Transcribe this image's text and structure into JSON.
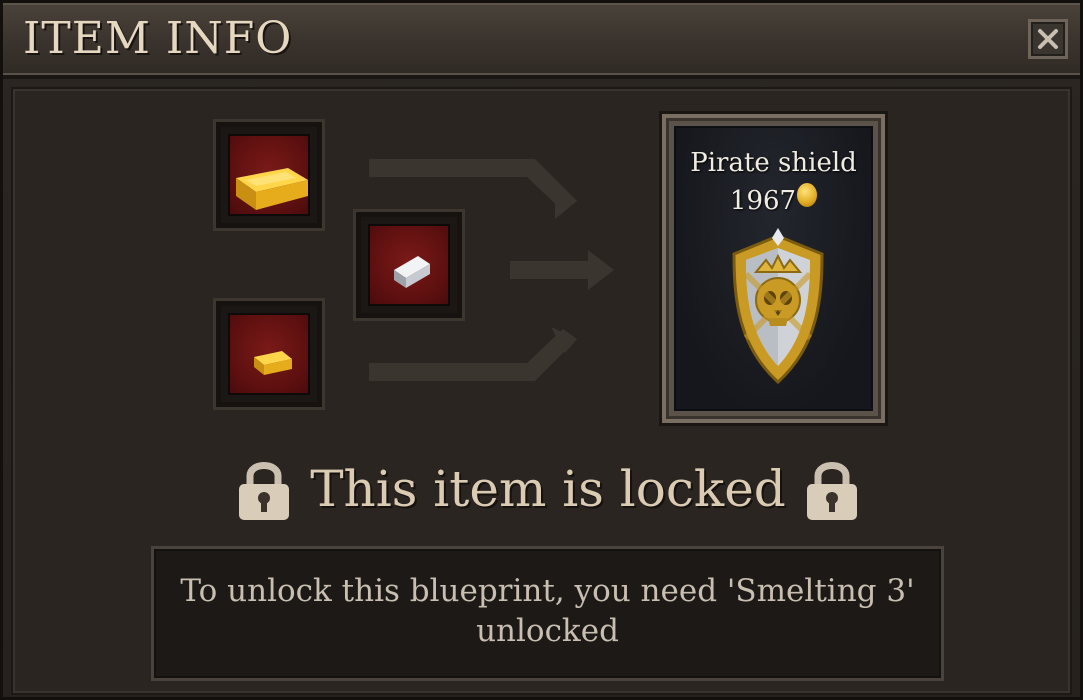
{
  "window": {
    "title": "ITEM INFO",
    "close_icon": "close-icon"
  },
  "recipe": {
    "inputs": [
      {
        "name": "gold-bar-large-icon",
        "material": "gold bar"
      },
      {
        "name": "silver-bar-icon",
        "material": "silver bar"
      },
      {
        "name": "gold-bar-small-icon",
        "material": "gold bar"
      }
    ],
    "output": {
      "name": "Pirate shield",
      "price": "1967",
      "currency_icon": "gold-coin-icon",
      "icon": "pirate-shield-icon"
    }
  },
  "lock_status": {
    "title": "This item is locked",
    "icon": "padlock-icon"
  },
  "unlock_message": {
    "text": "To unlock this blueprint, you need 'Smelting 3' unlocked"
  },
  "colors": {
    "slot_fill": "#5c0f0f",
    "title_text": "#e6d8c0",
    "gold": "#e0a91e"
  }
}
